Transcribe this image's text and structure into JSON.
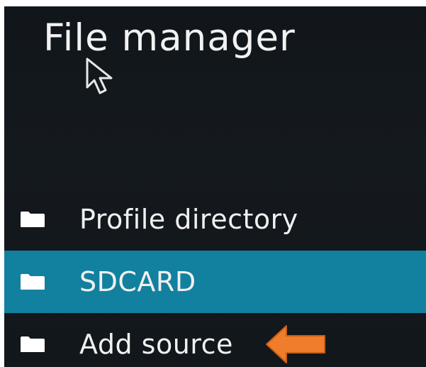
{
  "header": {
    "title": "File manager"
  },
  "list": {
    "items": [
      {
        "label": "Profile directory",
        "icon": "folder-icon",
        "selected": false
      },
      {
        "label": "SDCARD",
        "icon": "folder-icon",
        "selected": true
      },
      {
        "label": "Add source",
        "icon": "folder-icon",
        "selected": false
      }
    ]
  },
  "colors": {
    "background": "#12171c",
    "selected_row": "#12809f",
    "text": "#f0f0f0",
    "annotation_arrow": "#ef7d2c"
  },
  "overlay": {
    "cursor_icon": "mouse-pointer-icon",
    "annotation_icon": "orange-left-arrow-icon"
  }
}
